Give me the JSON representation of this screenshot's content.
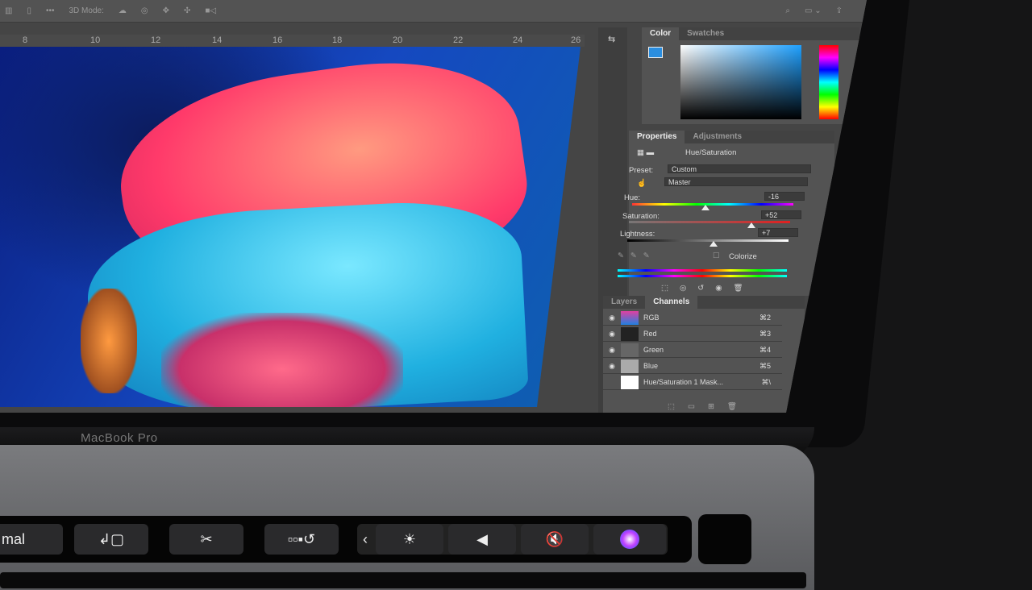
{
  "options_bar": {
    "mode_label": "3D Mode:"
  },
  "ruler": [
    "8",
    "10",
    "12",
    "14",
    "16",
    "18",
    "20",
    "22",
    "24",
    "26"
  ],
  "color_panel": {
    "tabs": [
      "Color",
      "Swatches"
    ]
  },
  "properties": {
    "tabs": [
      "Properties",
      "Adjustments"
    ],
    "adjustment": "Hue/Saturation",
    "preset_label": "Preset:",
    "preset_value": "Custom",
    "range_value": "Master",
    "hue_label": "Hue:",
    "hue_value": "-16",
    "hue_level": -16,
    "saturation_label": "Saturation:",
    "saturation_value": "+52",
    "saturation_level": 52,
    "lightness_label": "Lightness:",
    "lightness_value": "+7",
    "lightness_level": 7,
    "colorize_label": "Colorize"
  },
  "channels": {
    "tabs": [
      "Layers",
      "Channels"
    ],
    "items": [
      {
        "name": "RGB",
        "shortcut": "⌘2"
      },
      {
        "name": "Red",
        "shortcut": "⌘3"
      },
      {
        "name": "Green",
        "shortcut": "⌘4"
      },
      {
        "name": "Blue",
        "shortcut": "⌘5"
      },
      {
        "name": "Hue/Saturation 1 Mask...",
        "shortcut": "⌘\\"
      }
    ]
  },
  "laptop": {
    "brand": "MacBook Pro"
  },
  "touch_bar": {
    "blend_mode": "mal"
  }
}
